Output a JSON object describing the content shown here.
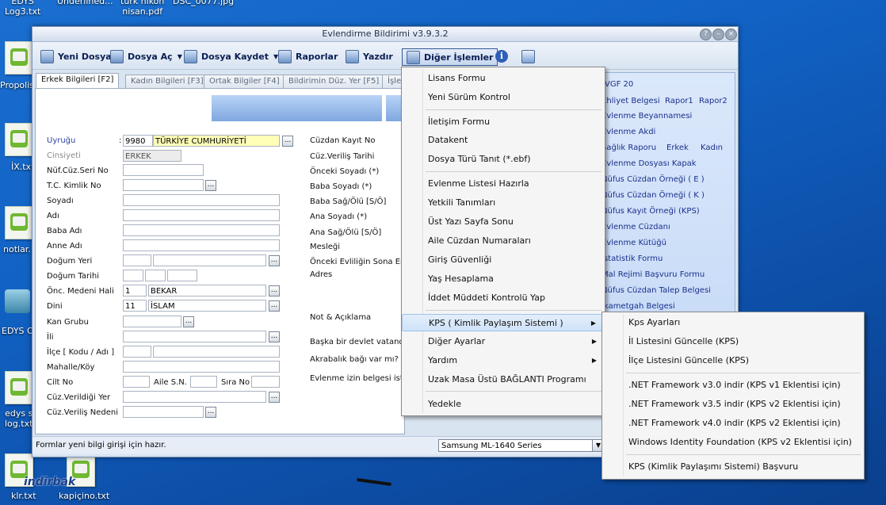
{
  "desktop": {
    "top_labels": [
      "EDYS\nLog3.txt",
      "Underlined...",
      "türk nikon\nnisan.pdf",
      "DSC_0077.jpg"
    ],
    "left_labels": [
      "Propolis",
      "İX.txt",
      "notlar.",
      "EDYS O",
      "edys s\nlog.txt",
      "klr.txt",
      "kapiçino.txt"
    ],
    "watermark": "indirbak"
  },
  "window": {
    "title": "Evlendirme Bildirimi v3.9.3.2",
    "controls": [
      "?",
      "–",
      "×"
    ]
  },
  "toolbar": {
    "new_doc": "Yeni Dosya",
    "open_doc": "Dosya Aç",
    "save_doc": "Dosya Kaydet",
    "reports": "Raporlar",
    "print": "Yazdır",
    "other": "Diğer İşlemler"
  },
  "tabs": [
    "Erkek Bilgileri [F2]",
    "Kadın Bilgileri [F3]",
    "Ortak Bilgiler [F4]",
    "Bildirimin Düz. Yer [F5]",
    "İşle"
  ],
  "form": {
    "nationality_label": "Uyruğu",
    "nationality_code": "9980",
    "nationality_name": "TÜRKİYE CUMHURİYETİ",
    "gender_label": "Cinsiyeti",
    "gender_value": "ERKEK",
    "labels": [
      "Nüf.Cüz.Seri No",
      "T.C. Kimlik No",
      "Soyadı",
      "Adı",
      "Baba Adı",
      "Anne Adı",
      "Doğum Yeri",
      "Doğum Tarihi",
      "Önc. Medeni Hali",
      "Dini",
      "Kan Grubu",
      "İli",
      "İlçe [ Kodu / Adı ]",
      "Mahalle/Köy",
      "Cilt No",
      "Cüz.Verildiği Yer",
      "Cüz.Veriliş Nedeni"
    ],
    "marital_code": "1",
    "marital_value": "BEKAR",
    "religion_code": "11",
    "religion_value": "İSLAM",
    "family_no_label": "Aile S.N.",
    "order_no_label": "Sıra No",
    "right_labels": [
      "Cüzdan Kayıt No",
      "Cüz.Veriliş Tarihi",
      "Önceki Soyadı (*)",
      "Baba Soyadı (*)",
      "Baba Sağ/Ölü [S/Ö]",
      "Ana Soyadı (*)",
      "Ana Sağ/Ölü [S/Ö]",
      "Mesleği",
      "Önceki Evliliğin Sona Eris",
      "Adres"
    ],
    "note_label": "Not & Açıklama",
    "other_state_label": "Başka bir devlet vatanda",
    "relation_label": "Akrabalık bağı var mı? [E",
    "permission_label": "Evlenme izin belgesi iste"
  },
  "right_panel": {
    "links": [
      "VGF 20",
      "Ehliyet Belgesi",
      "Rapor1",
      "Rapor2",
      "Evlenme Beyannamesi",
      "Evlenme Akdi",
      "Sağlık Raporu",
      "Erkek",
      "Kadın",
      "Evlenme Dosyası Kapak",
      "Nüfus Cüzdan Örneği ( E )",
      "Nüfus Cüzdan Örneği ( K )",
      "Nüfus Kayıt Örneği (KPS)",
      "Evlenme Cüzdanı",
      "Evlenme Kütüğü",
      "İstatistik Formu",
      "Mal Rejimi Başvuru Formu",
      "Nüfus Cüzdan Talep Belgesi",
      "İkametgah Belgesi"
    ]
  },
  "status": {
    "message": "Formlar yeni bilgi girişi için hazır.",
    "printer": "Samsung ML-1640 Series"
  },
  "menu": {
    "items": [
      "Lisans Formu",
      "Yeni Sürüm Kontrol",
      "İletişim Formu",
      "Datakent",
      "Dosya Türü Tanıt (*.ebf)",
      "Evlenme Listesi Hazırla",
      "Yetkili Tanımları",
      "Üst Yazı Sayfa Sonu",
      "Aile Cüzdan Numaraları",
      "Giriş Güvenliği",
      "Yaş Hesaplama",
      "İddet Müddeti Kontrolü Yap",
      "KPS ( Kimlik Paylaşım Sistemi )",
      "Diğer Ayarlar",
      "Yardım",
      "Uzak Masa Üstü BAĞLANTI Programı",
      "Yedekle"
    ]
  },
  "submenu": {
    "items": [
      "Kps Ayarları",
      "İl Listesini Güncelle (KPS)",
      "İlçe Listesini Güncelle (KPS)",
      ".NET Framework v3.0 indir (KPS v1 Eklentisi için)",
      ".NET Framework v3.5 indir (KPS v2 Eklentisi için)",
      ".NET Framework v4.0 indir (KPS v2 Eklentisi için)",
      "Windows Identity Foundation (KPS v2 Eklentisi için)",
      "KPS (Kimlik Paylaşımı Sistemi) Başvuru"
    ]
  }
}
